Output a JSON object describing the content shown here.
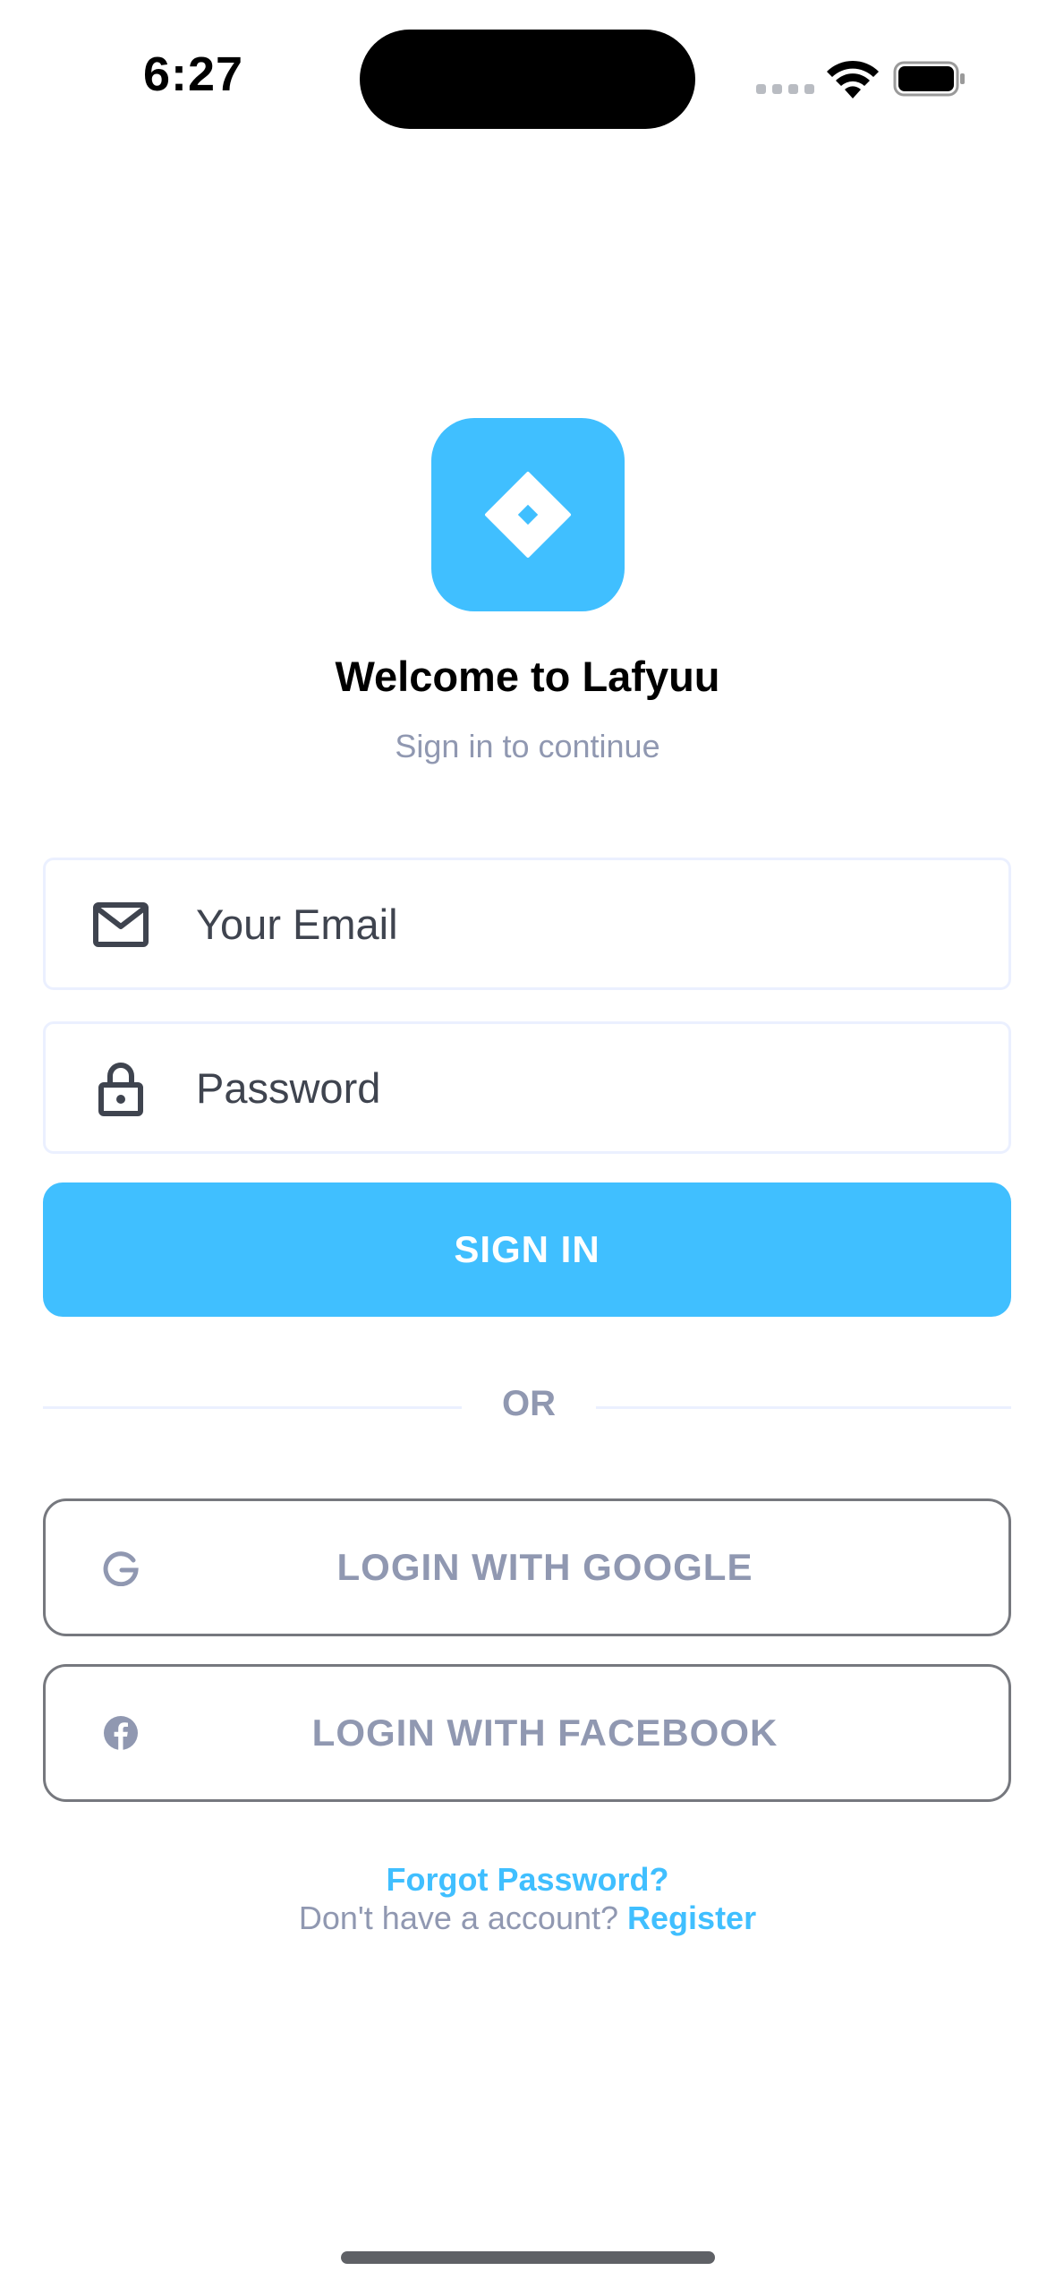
{
  "status_bar": {
    "time": "6:27"
  },
  "header": {
    "title": "Welcome to Lafyuu",
    "subtitle": "Sign in to continue"
  },
  "form": {
    "email_placeholder": "Your Email",
    "password_placeholder": "Password",
    "signin_label": "SIGN IN"
  },
  "divider": {
    "label": "OR"
  },
  "social": {
    "google_label": "LOGIN WITH GOOGLE",
    "facebook_label": "LOGIN WITH FACEBOOK"
  },
  "footer": {
    "forgot_label": "Forgot Password?",
    "no_account_text": "Don't have a account?",
    "register_label": "Register"
  },
  "colors": {
    "accent": "#40bfff",
    "muted": "#9098b1",
    "border": "#ebf0ff"
  },
  "icons": {
    "logo": "diamond-logo-icon",
    "email": "mail-icon",
    "password": "lock-icon",
    "google": "google-icon",
    "facebook": "facebook-icon"
  }
}
